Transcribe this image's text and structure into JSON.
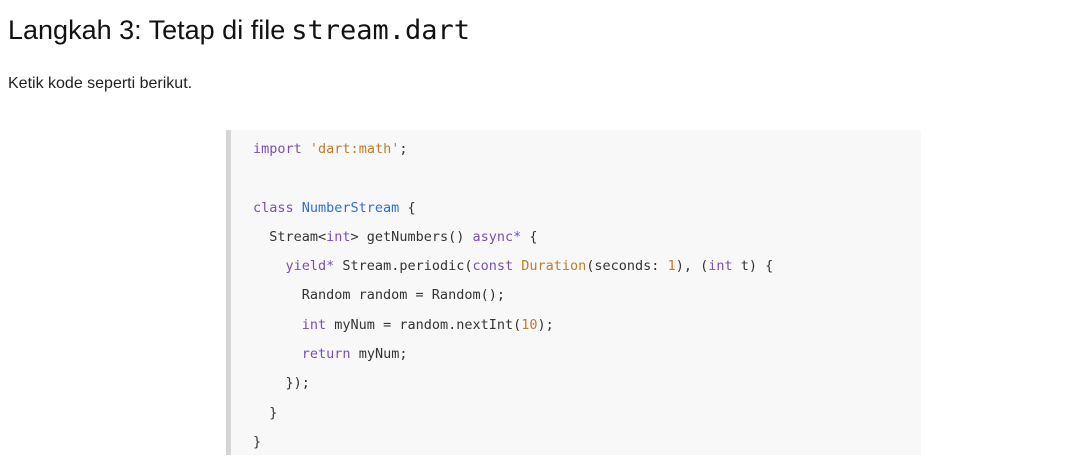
{
  "heading": {
    "text": "Langkah 3: Tetap di file",
    "code": "stream.dart"
  },
  "intro": "Ketik kode seperti berikut.",
  "colors": {
    "keyword": "#7a4fb2",
    "string": "#c07c2a",
    "type": "#2f6fd0",
    "number": "#c07c2a",
    "plain": "#333333",
    "code_background": "#f8f8f8",
    "code_border": "#d5d5d5"
  },
  "code": {
    "language": "dart",
    "lines": [
      [
        {
          "text": "import",
          "type": "keyword"
        },
        {
          "text": " ",
          "type": "plain"
        },
        {
          "text": "'dart:math'",
          "type": "string"
        },
        {
          "text": ";",
          "type": "plain"
        }
      ],
      [],
      [
        {
          "text": "class",
          "type": "keyword"
        },
        {
          "text": " ",
          "type": "plain"
        },
        {
          "text": "NumberStream",
          "type": "type"
        },
        {
          "text": " {",
          "type": "plain"
        }
      ],
      [
        {
          "text": "  Stream<",
          "type": "plain"
        },
        {
          "text": "int",
          "type": "keyword"
        },
        {
          "text": "> getNumbers() ",
          "type": "plain"
        },
        {
          "text": "async*",
          "type": "keyword"
        },
        {
          "text": " {",
          "type": "plain"
        }
      ],
      [
        {
          "text": "    ",
          "type": "plain"
        },
        {
          "text": "yield*",
          "type": "keyword"
        },
        {
          "text": " Stream.periodic(",
          "type": "plain"
        },
        {
          "text": "const",
          "type": "keyword"
        },
        {
          "text": " ",
          "type": "plain"
        },
        {
          "text": "Duration",
          "type": "string"
        },
        {
          "text": "(seconds: ",
          "type": "plain"
        },
        {
          "text": "1",
          "type": "number"
        },
        {
          "text": "), (",
          "type": "plain"
        },
        {
          "text": "int",
          "type": "keyword"
        },
        {
          "text": " t) {",
          "type": "plain"
        }
      ],
      [
        {
          "text": "      Random random = Random();",
          "type": "plain"
        }
      ],
      [
        {
          "text": "      ",
          "type": "plain"
        },
        {
          "text": "int",
          "type": "keyword"
        },
        {
          "text": " myNum = random.nextInt(",
          "type": "plain"
        },
        {
          "text": "10",
          "type": "number"
        },
        {
          "text": ");",
          "type": "plain"
        }
      ],
      [
        {
          "text": "      ",
          "type": "plain"
        },
        {
          "text": "return",
          "type": "keyword"
        },
        {
          "text": " myNum;",
          "type": "plain"
        }
      ],
      [
        {
          "text": "    });",
          "type": "plain"
        }
      ],
      [
        {
          "text": "  }",
          "type": "plain"
        }
      ],
      [
        {
          "text": "}",
          "type": "plain"
        }
      ]
    ]
  }
}
